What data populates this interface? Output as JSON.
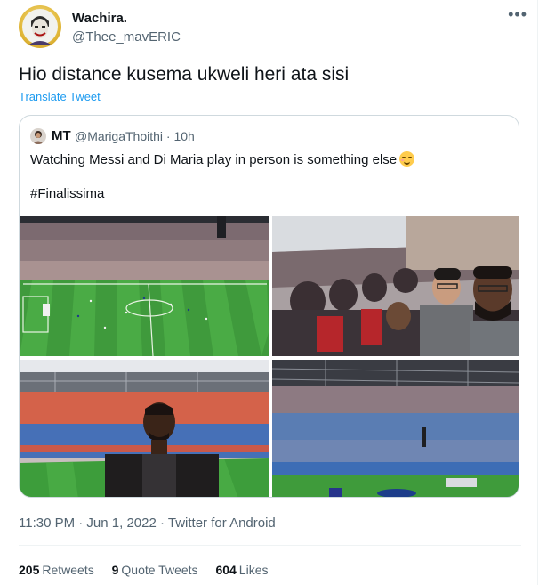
{
  "author": {
    "name": "Wachira.",
    "handle": "@Thee_mavERIC"
  },
  "tweet": {
    "text": "Hio distance kusema ukweli heri ata sisi",
    "translate_label": "Translate Tweet"
  },
  "quoted": {
    "name": "MT",
    "meta": "@MarigaThoithi · 10h",
    "text": "Watching Messi and Di Maria play in person is something else",
    "hashtag": "#Finalissima"
  },
  "footer": {
    "time_line": "11:30 PM · Jun 1, 2022 · Twitter for Android",
    "retweets_count": "205",
    "retweets_label": "Retweets",
    "quotes_count": "9",
    "quotes_label": "Quote Tweets",
    "likes_count": "604",
    "likes_label": "Likes"
  },
  "icons": {
    "more": "more-horizontal-icon",
    "emoji": "smiling-face-emoji"
  },
  "colors": {
    "link": "#1d9bf0",
    "secondary_text": "#536471",
    "border": "#cfd9de"
  }
}
